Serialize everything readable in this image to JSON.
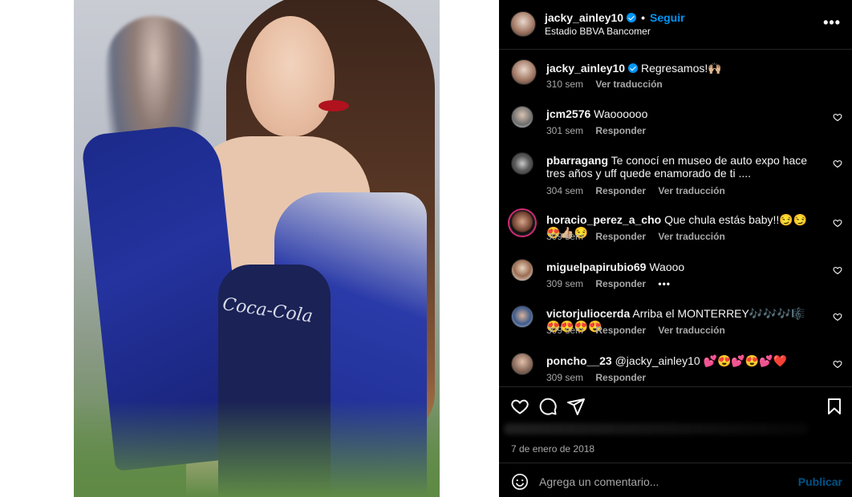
{
  "post": {
    "username": "jacky_ainley10",
    "follow_label": "Seguir",
    "location": "Estadio BBVA Bancomer",
    "dot": "•",
    "more_label": "•••",
    "date": "7 de enero de 2018",
    "photo_text": "Coca-Cola"
  },
  "caption": {
    "username": "jacky_ainley10",
    "text": "Regresamos!🙌🏼",
    "time": "310 sem",
    "translate": "Ver traducción"
  },
  "comments": [
    {
      "username": "jcm2576",
      "text": "Waoooooo",
      "time": "301 sem",
      "reply": "Responder",
      "translate": "",
      "more": ""
    },
    {
      "username": "pbarragang",
      "text": "Te conocí en museo de auto expo hace tres años y uff quede enamorado de ti ....",
      "time": "304 sem",
      "reply": "Responder",
      "translate": "Ver traducción",
      "more": ""
    },
    {
      "username": "horacio_perez_a_cho",
      "text": "Que chula estás baby!!😏😏😍👍🏼😏",
      "time": "309 sem",
      "reply": "Responder",
      "translate": "Ver traducción",
      "more": ""
    },
    {
      "username": "miguelpapirubio69",
      "text": "Waooo",
      "time": "309 sem",
      "reply": "Responder",
      "translate": "",
      "more": "•••"
    },
    {
      "username": "victorjuliocerda",
      "text": "Arriba el MONTERREY🎶🎶🎶🎼😍😍😍😍",
      "time": "309 sem",
      "reply": "Responder",
      "translate": "Ver traducción",
      "more": ""
    },
    {
      "username": "poncho__23",
      "text": "@jacky_ainley10 💕😍💕😍💕❤️",
      "time": "309 sem",
      "reply": "Responder",
      "translate": "",
      "more": ""
    }
  ],
  "composer": {
    "placeholder": "Agrega un comentario...",
    "publish_label": "Publicar"
  },
  "colors": {
    "panel_bg": "#000000",
    "accent": "#0095f6",
    "secondary_text": "#a8a8a8",
    "divider": "#262626"
  }
}
